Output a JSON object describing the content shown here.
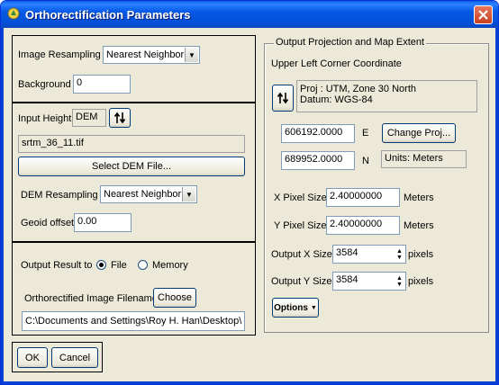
{
  "window": {
    "title": "Orthorectification Parameters"
  },
  "resampling": {
    "label": "Image Resampling",
    "value": "Nearest Neighbor",
    "background_label": "Background",
    "background_value": "0"
  },
  "dem": {
    "input_height_label": "Input Height",
    "input_height_value": "DEM",
    "swap_icon": "up-down-arrows",
    "file_value": "srtm_36_11.tif",
    "select_button": "Select DEM File...",
    "resampling_label": "DEM Resampling",
    "resampling_value": "Nearest Neighbor",
    "geoid_label": "Geoid offset",
    "geoid_value": "0.00"
  },
  "output": {
    "result_label": "Output Result to",
    "options": [
      "File",
      "Memory"
    ],
    "selected": "File",
    "filename_label": "Orthorectified Image Filename",
    "choose_button": "Choose",
    "filename_value": "C:\\Documents and Settings\\Roy H. Han\\Desktop\\"
  },
  "projection": {
    "group_title": "Output Projection and Map Extent",
    "ulc_label": "Upper Left Corner Coordinate",
    "proj_line1": "Proj : UTM, Zone 30 North",
    "proj_line2": "Datum: WGS-84",
    "easting_value": "606192.0000",
    "easting_label": "E",
    "northing_value": "689952.0000",
    "northing_label": "N",
    "change_proj_button": "Change Proj...",
    "units_text": "Units: Meters",
    "x_pixel_label": "X Pixel Size",
    "x_pixel_value": "2.40000000",
    "x_pixel_unit": "Meters",
    "y_pixel_label": "Y Pixel Size",
    "y_pixel_value": "2.40000000",
    "y_pixel_unit": "Meters",
    "out_x_label": "Output X Size",
    "out_x_value": "3584",
    "out_x_unit": "pixels",
    "out_y_label": "Output Y Size",
    "out_y_value": "3584",
    "out_y_unit": "pixels",
    "options_button": "Options"
  },
  "footer": {
    "ok": "OK",
    "cancel": "Cancel"
  }
}
